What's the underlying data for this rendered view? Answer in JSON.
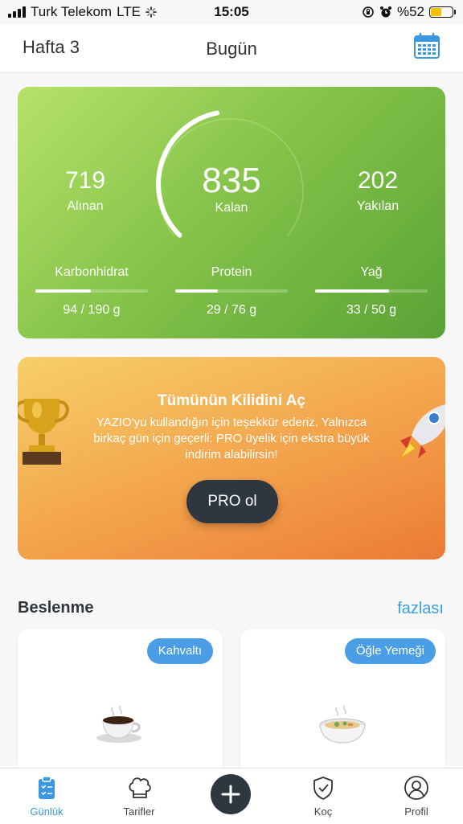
{
  "status_bar": {
    "carrier": "Turk Telekom",
    "network": "LTE",
    "time": "15:05",
    "battery": "%52",
    "battery_level": 0.52
  },
  "header": {
    "week": "Hafta 3",
    "title": "Bugün",
    "calendar_icon": "calendar-icon"
  },
  "summary": {
    "eaten_value": "719",
    "eaten_label": "Alınan",
    "remaining_value": "835",
    "remaining_label": "Kalan",
    "burned_value": "202",
    "burned_label": "Yakılan",
    "ring_progress": 0.46,
    "macros": [
      {
        "name": "Karbonhidrat",
        "value": "94 / 190 g",
        "progress": 0.49
      },
      {
        "name": "Protein",
        "value": "29 / 76 g",
        "progress": 0.38
      },
      {
        "name": "Yağ",
        "value": "33 / 50 g",
        "progress": 0.66
      }
    ],
    "colors": {
      "gradient_start": "#b6e26a",
      "gradient_end": "#5aa236"
    }
  },
  "promo": {
    "title": "Tümünün Kilidini Aç",
    "body": "YAZIO'yu kullandığın için teşekkür ederiz. Yalnızca birkaç gün için geçerli: PRO üyelik için ekstra büyük indirim alabilirsin!",
    "button": "PRO ol",
    "icons": [
      "trophy-icon",
      "rocket-icon"
    ]
  },
  "nutrition": {
    "title": "Beslenme",
    "more": "fazlası",
    "meals": [
      {
        "label": "Kahvaltı",
        "icon": "coffee-cup-icon"
      },
      {
        "label": "Öğle Yemeği",
        "icon": "soup-bowl-icon"
      }
    ]
  },
  "tabs": [
    {
      "label": "Günlük",
      "icon": "diary-icon",
      "active": true
    },
    {
      "label": "Tarifler",
      "icon": "chef-hat-icon",
      "active": false
    },
    {
      "label": "Koç",
      "icon": "shield-check-icon",
      "active": false
    },
    {
      "label": "Profil",
      "icon": "profile-icon",
      "active": false
    }
  ],
  "fab_icon": "plus-icon"
}
